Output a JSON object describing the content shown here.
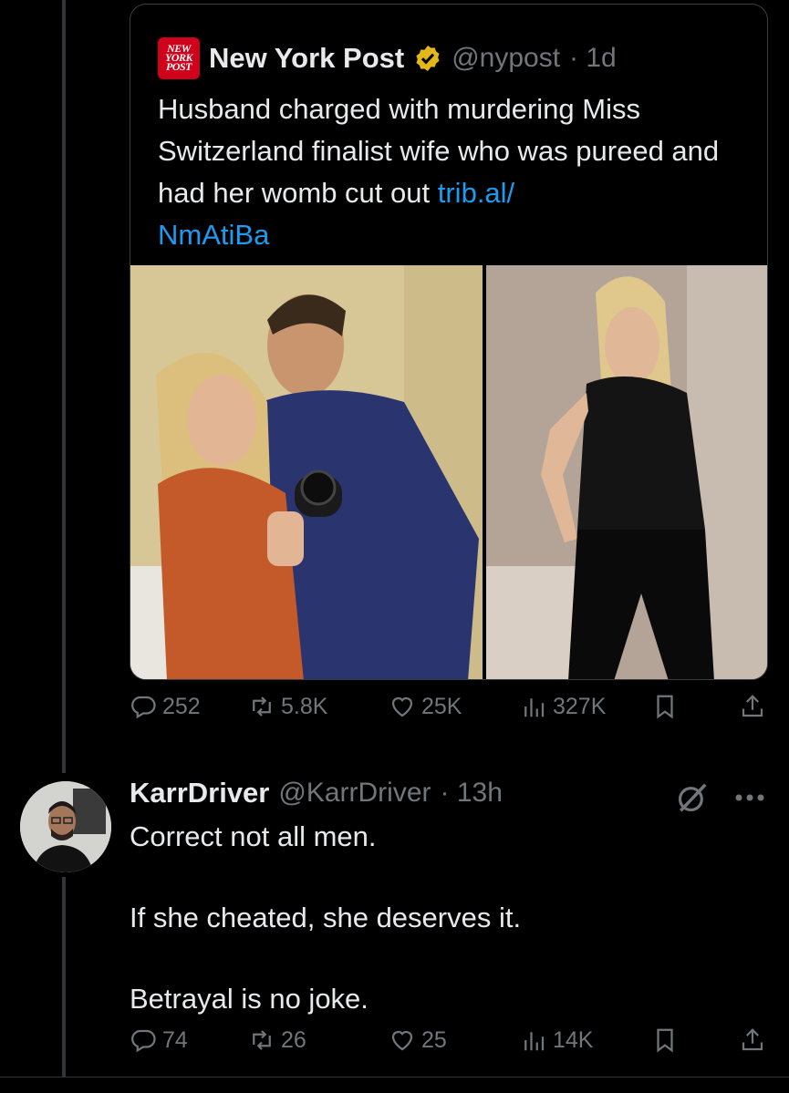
{
  "quoted_post": {
    "author_name": "New York Post",
    "author_handle": "@nypost",
    "time": "· 1d",
    "logo_lines": [
      "NEW",
      "YORK",
      "POST"
    ],
    "text": "Husband charged with murdering Miss Switzerland finalist wife who was pureed and had her womb cut out",
    "link_line1": "trib.al/",
    "link_line2": "NmAtiBa",
    "media": [
      "couple-photo",
      "woman-photo"
    ],
    "stats": {
      "replies": "252",
      "reposts": "5.8K",
      "likes": "25K",
      "views": "327K"
    }
  },
  "reply": {
    "author_name": "KarrDriver",
    "author_handle": "@KarrDriver",
    "time": "· 13h",
    "lines": [
      "Correct not all men.",
      "If she cheated, she deserves it.",
      "Betrayal is no joke."
    ],
    "stats": {
      "replies": "74",
      "reposts": "26",
      "likes": "25",
      "views": "14K"
    }
  },
  "colors": {
    "background": "#000000",
    "text": "#e7e9ea",
    "muted": "#71767b",
    "link": "#1d9bf0",
    "verified_gold": "#e2b719",
    "nyp_red": "#d0021b"
  },
  "icons": [
    "reply-icon",
    "repost-icon",
    "like-icon",
    "views-icon",
    "bookmark-icon",
    "share-icon",
    "grok-icon",
    "more-icon",
    "verified-badge-icon"
  ]
}
